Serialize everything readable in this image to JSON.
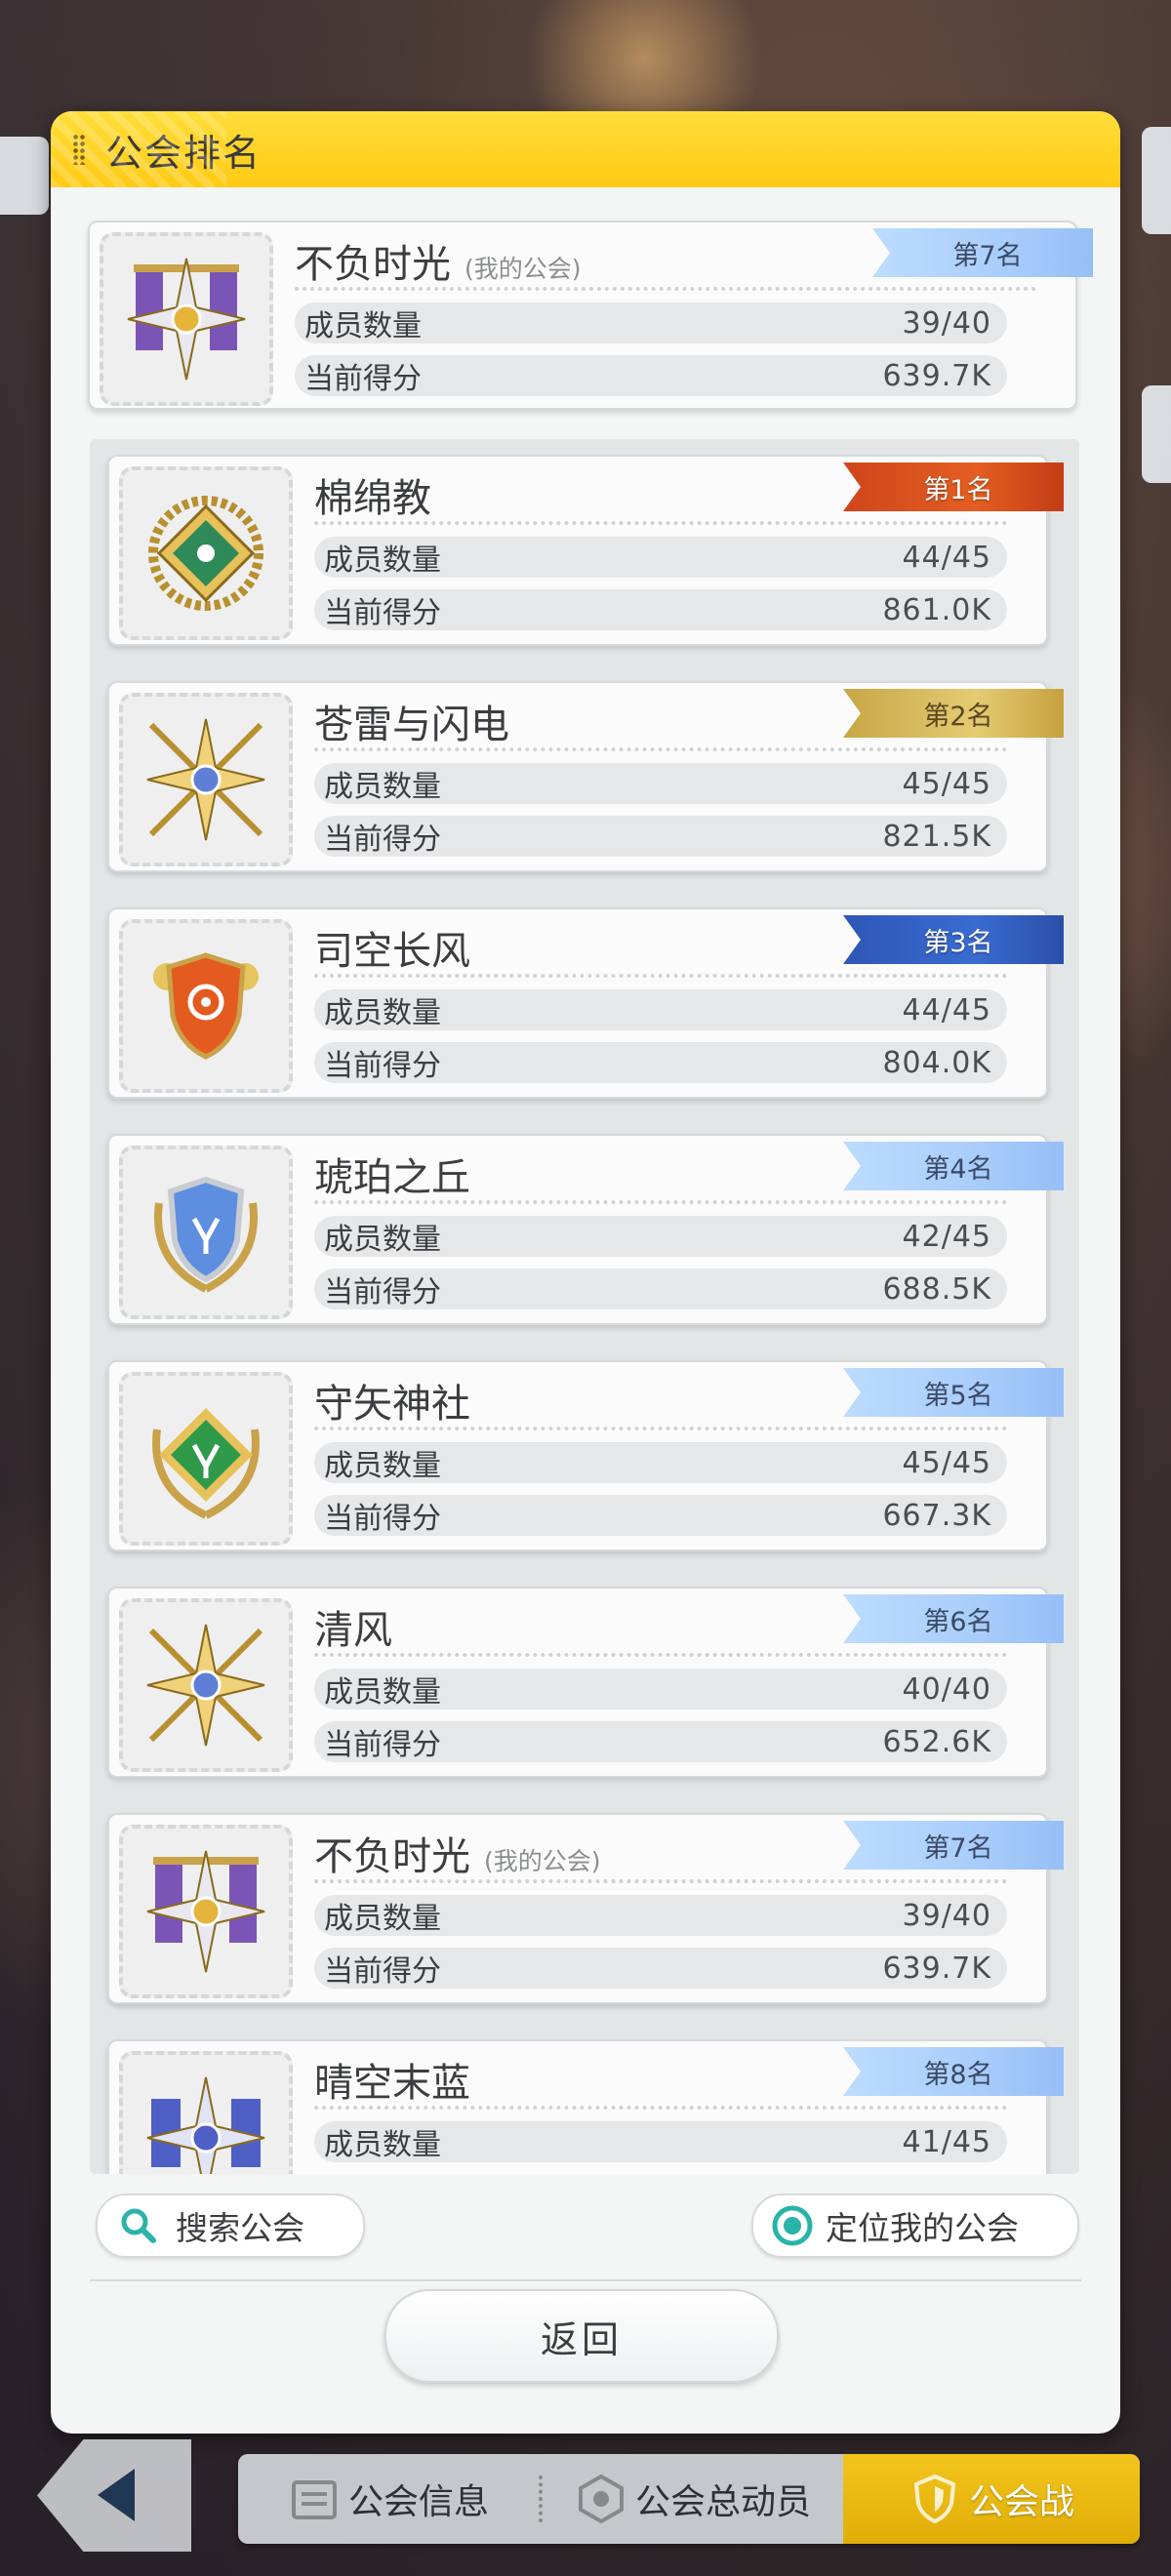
{
  "dialog": {
    "title": "公会排名"
  },
  "labels": {
    "members": "成员数量",
    "score": "当前得分",
    "mine": "(我的公会)"
  },
  "my_guild": {
    "name": "不负时光",
    "rank_label": "第7名",
    "members": "39/40",
    "score": "639.7K",
    "emblem": "purple-banner-compass-icon"
  },
  "guilds": [
    {
      "name": "棉绵教",
      "rank_label": "第1名",
      "members": "44/45",
      "score": "861.0K",
      "emblem": "thorn-wreath-green-diamond-icon",
      "ribbon": "red",
      "mine": false
    },
    {
      "name": "苍雷与闪电",
      "rank_label": "第2名",
      "members": "45/45",
      "score": "821.5K",
      "emblem": "golden-crossed-spears-star-icon",
      "ribbon": "gold",
      "mine": false
    },
    {
      "name": "司空长风",
      "rank_label": "第3名",
      "members": "44/45",
      "score": "804.0K",
      "emblem": "orange-shield-floral-icon",
      "ribbon": "blue",
      "mine": false
    },
    {
      "name": "琥珀之丘",
      "rank_label": "第4名",
      "members": "42/45",
      "score": "688.5K",
      "emblem": "blue-shield-deer-laurel-icon",
      "ribbon": "light",
      "mine": false
    },
    {
      "name": "守矢神社",
      "rank_label": "第5名",
      "members": "45/45",
      "score": "667.3K",
      "emblem": "green-diamond-deer-laurel-icon",
      "ribbon": "light",
      "mine": false
    },
    {
      "name": "清风",
      "rank_label": "第6名",
      "members": "40/40",
      "score": "652.6K",
      "emblem": "golden-crossed-spears-star-icon",
      "ribbon": "light",
      "mine": false
    },
    {
      "name": "不负时光",
      "rank_label": "第7名",
      "members": "39/40",
      "score": "639.7K",
      "emblem": "purple-banner-compass-icon",
      "ribbon": "light",
      "mine": true
    },
    {
      "name": "晴空末蓝",
      "rank_label": "第8名",
      "members": "41/45",
      "score": "",
      "emblem": "blue-compass-crossed-flags-icon",
      "ribbon": "light",
      "mine": false
    }
  ],
  "actions": {
    "search": "搜索公会",
    "locate": "定位我的公会",
    "back": "返回"
  },
  "tabs": [
    {
      "label": "公会信息",
      "icon": "guild-info-icon",
      "active": false
    },
    {
      "label": "公会总动员",
      "icon": "guild-mobilize-icon",
      "active": false
    },
    {
      "label": "公会战",
      "icon": "guild-war-shield-icon",
      "active": true
    }
  ],
  "colors": {
    "header": "#ffcf1f",
    "active_tab": "#e7b20b",
    "ribbon_red": "#d84e1e",
    "ribbon_gold": "#d6b858",
    "ribbon_blue": "#3462c2",
    "ribbon_light": "#aed0fb"
  }
}
